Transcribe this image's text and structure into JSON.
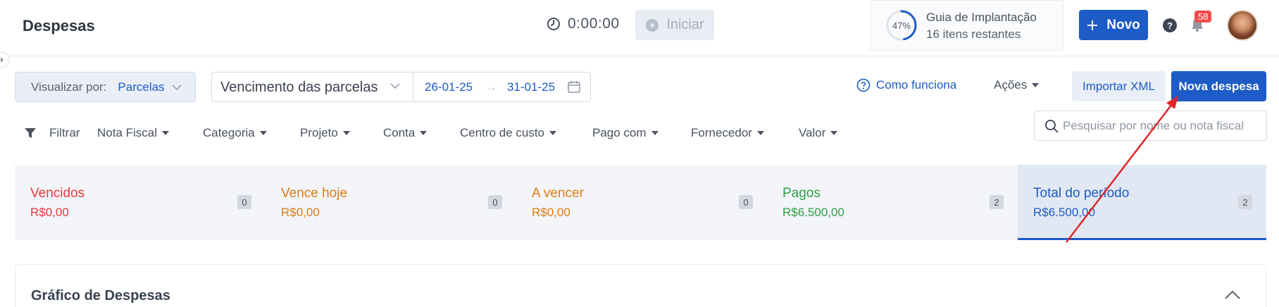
{
  "header": {
    "title": "Despesas",
    "timer": "0:00:00",
    "start_label": "Iniciar",
    "guide": {
      "percent": "47%",
      "progress": 0.47,
      "title": "Guia de Implantação",
      "subtitle": "16 itens restantes"
    },
    "new_label": "Novo",
    "help_label": "?",
    "notifications_count": "58"
  },
  "toolbar": {
    "view_by_label": "Visualizar por:",
    "view_by_value": "Parcelas",
    "date_type": "Vencimento das parcelas",
    "date_from": "26-01-25",
    "date_to": "31-01-25",
    "how_works": "Como funciona",
    "actions": "Ações",
    "import_xml": "Importar XML",
    "new_expense": "Nova despesa"
  },
  "filters": {
    "label": "Filtrar",
    "items": [
      "Nota Fiscal",
      "Categoria",
      "Projeto",
      "Conta",
      "Centro de custo",
      "Pago com",
      "Fornecedor",
      "Valor"
    ],
    "search_placeholder": "Pesquisar por nome ou nota fiscal"
  },
  "summary": [
    {
      "label": "Vencidos",
      "value": "R$0,00",
      "count": "0",
      "color": "#e5383b"
    },
    {
      "label": "Vence hoje",
      "value": "R$0,00",
      "count": "0",
      "color": "#e07b12"
    },
    {
      "label": "A vencer",
      "value": "R$0,00",
      "count": "0",
      "color": "#e07b12"
    },
    {
      "label": "Pagos",
      "value": "R$6.500,00",
      "count": "2",
      "color": "#2f9e44"
    },
    {
      "label": "Total do período",
      "value": "R$6.500,00",
      "count": "2",
      "color": "#1d5bc7"
    }
  ],
  "chart_panel": {
    "title": "Gráfico de Despesas"
  },
  "colors": {
    "primary": "#1d5bc7",
    "annotation": "#e0262b"
  }
}
